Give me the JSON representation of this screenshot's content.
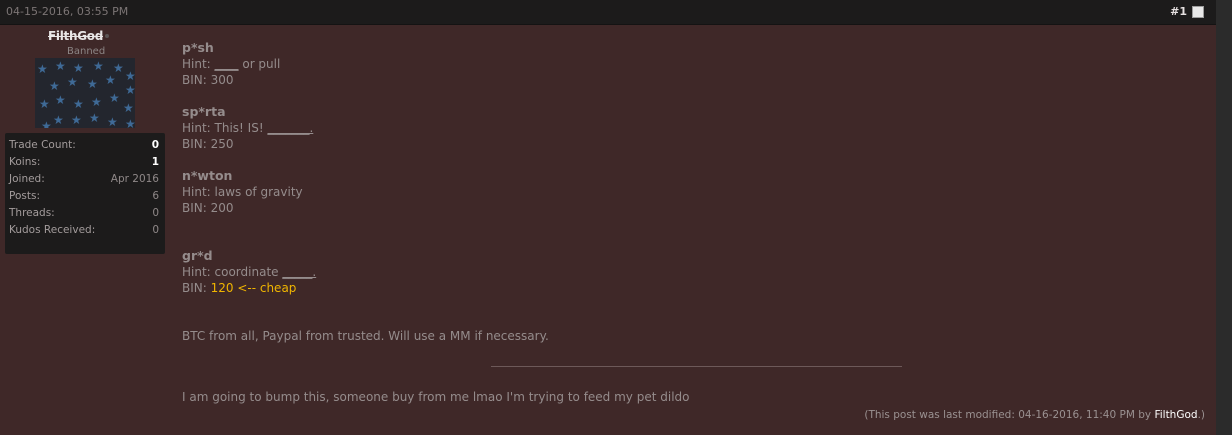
{
  "post": {
    "date": "04-15-2016, 03:55 PM",
    "number": "#1"
  },
  "user": {
    "name": "FilthGod",
    "title": "Banned",
    "stats": [
      {
        "label": "Trade Count:",
        "value": "0"
      },
      {
        "label": "Koins:",
        "value": "1"
      },
      {
        "label": "Joined:",
        "value": "Apr 2016"
      },
      {
        "label": "Posts:",
        "value": "6"
      },
      {
        "label": "Threads:",
        "value": "0"
      },
      {
        "label": "Kudos Received:",
        "value": "0"
      }
    ]
  },
  "items": [
    {
      "name": "p*sh",
      "hint_prefix": "Hint: ",
      "hint_blank": "____",
      "hint_suffix": " or pull",
      "bin": "BIN: 300"
    },
    {
      "name": "sp*rta",
      "hint_prefix": "Hint: This! IS! ",
      "hint_blank": "_______.",
      "hint_suffix": "",
      "bin": "BIN: 250"
    },
    {
      "name": "n*wton",
      "hint_prefix": "Hint: laws of gravity",
      "hint_blank": "",
      "hint_suffix": "",
      "bin": "BIN: 200"
    },
    {
      "name": "gr*d",
      "hint_prefix": "Hint: coordinate ",
      "hint_blank": "_____.",
      "hint_suffix": "",
      "bin_prefix": "BIN: ",
      "bin_highlight": "120 <-- cheap"
    }
  ],
  "payment_text": "BTC from all, Paypal from trusted. Will use a MM if necessary.",
  "bump_text": "I am going to bump this, someone buy from me lmao I'm trying to feed my pet dildo",
  "modified": {
    "prefix": "(This post was last modified: 04-16-2016, 11:40 PM by ",
    "user": "FilthGod",
    "suffix": ".)"
  },
  "colors": {
    "post_background": "#3f2828",
    "header_background": "#1c1b1b",
    "highlight": "#f0b500"
  }
}
